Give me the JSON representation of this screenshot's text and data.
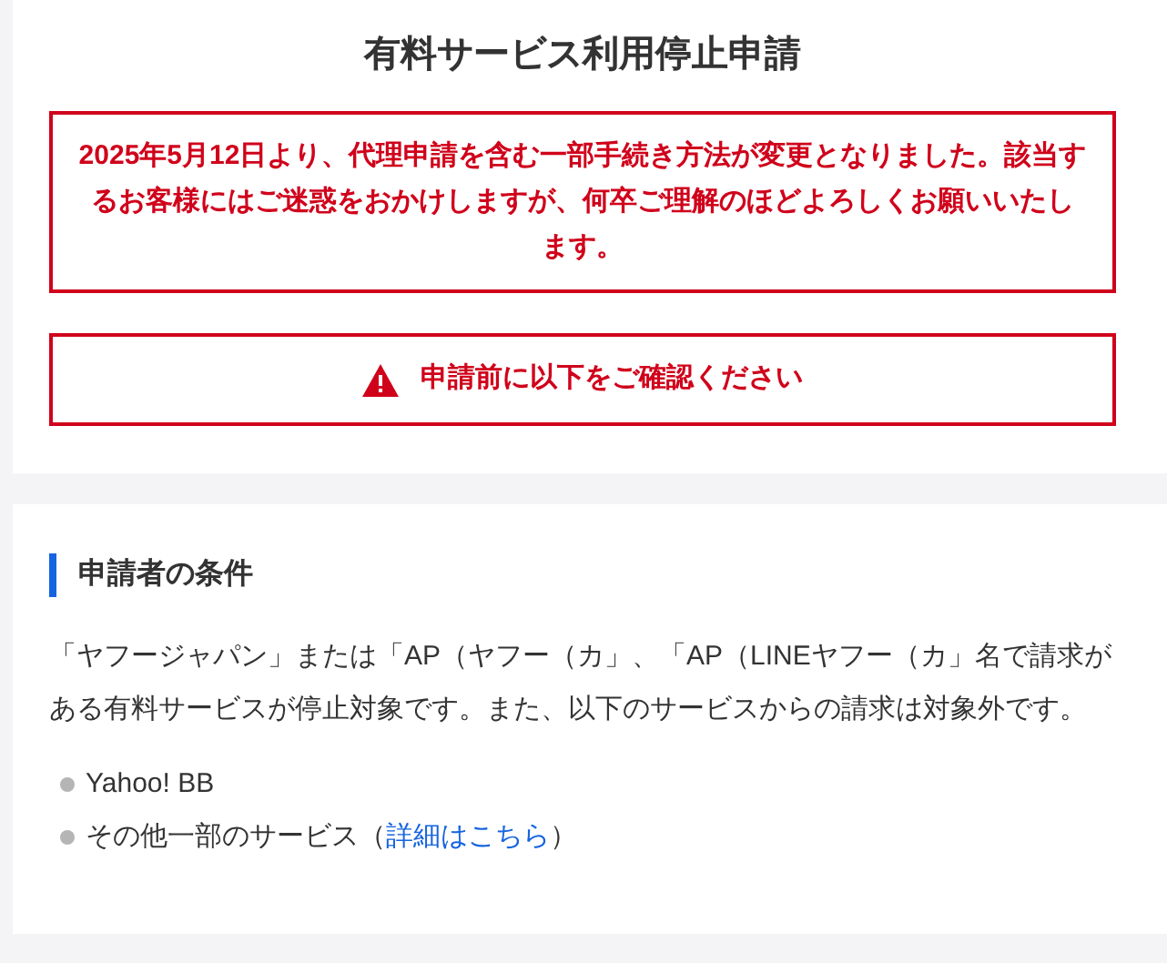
{
  "title": "有料サービス利用停止申請",
  "notice": "2025年5月12日より、代理申請を含む一部手続き方法が変更となりました。該当するお客様にはご迷惑をおかけしますが、何卒ご理解のほどよろしくお願いいたします。",
  "confirm_button": {
    "label": "申請前に以下をご確認ください"
  },
  "conditions": {
    "heading": "申請者の条件",
    "description": "「ヤフージャパン」または「AP（ヤフー（カ」、「AP（LINEヤフー（カ」名で請求がある有料サービスが停止対象です。また、以下のサービスからの請求は対象外です。",
    "items": [
      {
        "text": "Yahoo! BB"
      },
      {
        "text": "その他一部のサービス（",
        "link": "詳細はこちら",
        "suffix": "）"
      }
    ]
  }
}
